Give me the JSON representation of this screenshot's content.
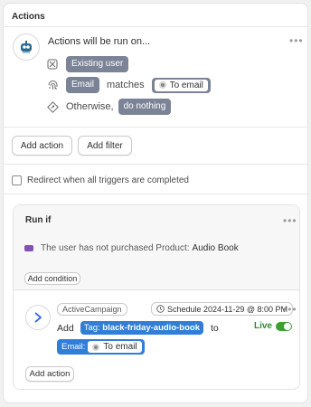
{
  "panel": {
    "title": "Actions",
    "run_on": "Actions will be run on...",
    "existing_user": "Existing user",
    "email_tag": "Email",
    "matches": "matches",
    "to_email": "To email",
    "otherwise": "Otherwise,",
    "do_nothing": "do nothing",
    "add_action": "Add action",
    "add_filter": "Add filter",
    "redirect_label": "Redirect when all triggers are completed"
  },
  "run_if": {
    "title": "Run if",
    "condition_prefix": "The user has not purchased Product:",
    "condition_value": "Audio Book",
    "add_condition": "Add condition"
  },
  "activecampaign": {
    "badge": "ActiveCampaign",
    "schedule": "Schedule 2024-11-29 @ 8:00 PM",
    "add_word": "Add",
    "tag_label": "Tag:",
    "tag_value": "black-friday-audio-book",
    "to_word": "to",
    "email_label": "Email:",
    "email_value": "To email",
    "live": "Live",
    "add_action": "Add action"
  },
  "icons": [
    "robot-avatar-icon",
    "user-x-icon",
    "fingerprint-icon",
    "diamond-arrow-icon",
    "woocommerce-icon",
    "activecampaign-chevron-icon",
    "clock-icon",
    "more-dots-icon"
  ],
  "colors": {
    "tag_grey": "#7b8396",
    "tag_blue": "#2f7ed8",
    "live_green": "#3aa12f",
    "woo_purple": "#7f54b3"
  }
}
